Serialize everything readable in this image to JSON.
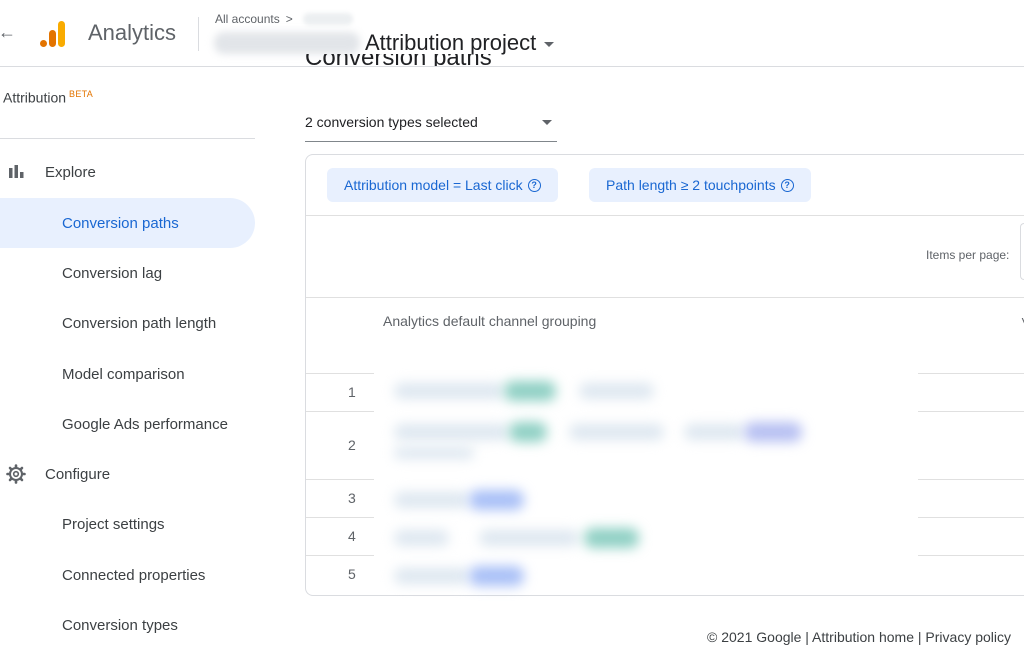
{
  "header": {
    "app_title": "Analytics",
    "breadcrumb_root": "All accounts",
    "breadcrumb_sep": ">",
    "project_title": "Attribution project"
  },
  "sidebar": {
    "heading": "Attribution",
    "beta": "BETA",
    "explore_label": "Explore",
    "configure_label": "Configure",
    "explore_items": [
      {
        "label": "Conversion paths",
        "active": true
      },
      {
        "label": "Conversion lag"
      },
      {
        "label": "Conversion path length"
      },
      {
        "label": "Model comparison"
      },
      {
        "label": "Google Ads performance"
      }
    ],
    "configure_items": [
      {
        "label": "Project settings"
      },
      {
        "label": "Connected properties"
      },
      {
        "label": "Conversion types"
      }
    ]
  },
  "main": {
    "title": "Conversion paths",
    "conversion_select": "2 conversion types selected",
    "chips": [
      "Attribution model = Last click",
      "Path length ≥ 2 touchpoints"
    ],
    "help_glyph": "?",
    "items_per_page_label": "Items per page:",
    "column_header": "Analytics default channel grouping",
    "column_chevron": "˅",
    "rows": [
      "1",
      "2",
      "3",
      "4",
      "5"
    ]
  },
  "footer": {
    "text": "© 2021 Google | Attribution home | Privacy policy"
  },
  "colors": {
    "accent": "#1967d2",
    "active_bg": "#e8f0fe",
    "logo_orange": "#f9ab00",
    "logo_dark_orange": "#e37400",
    "beta": "#e37400"
  },
  "icons": [
    "back-arrow-icon",
    "analytics-logo-icon",
    "chevron-right-icon",
    "dropdown-caret-icon",
    "bar-chart-icon",
    "gear-icon",
    "help-circle-icon"
  ]
}
